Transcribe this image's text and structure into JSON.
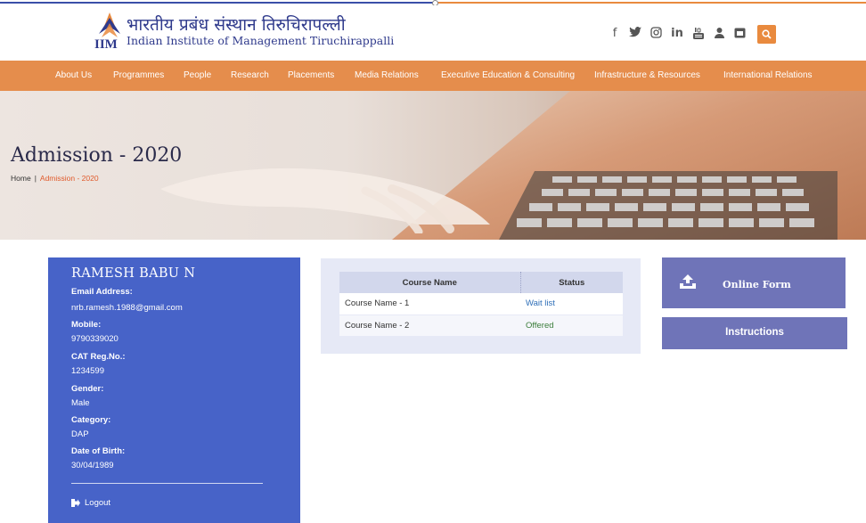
{
  "header": {
    "hindi_name": "भारतीय प्रबंध संस्थान तिरुचिरापल्ली",
    "english_name": "Indian Institute of Management Tiruchirappalli",
    "logo_text": "IIM",
    "logo_sub": "TRICHY",
    "social_icons": [
      "facebook-icon",
      "twitter-icon",
      "instagram-icon",
      "linkedin-icon",
      "youtube-icon",
      "user-icon",
      "calendar-icon"
    ],
    "linkedin_text": "in",
    "facebook_text": "f"
  },
  "nav": {
    "items": [
      "About Us",
      "Programmes",
      "People",
      "Research",
      "Placements",
      "Media Relations",
      "Executive Education & Consulting",
      "Infrastructure & Resources",
      "International Relations"
    ]
  },
  "banner": {
    "title": "Admission - 2020",
    "breadcrumb_home": "Home",
    "breadcrumb_sep": "|",
    "breadcrumb_current": "Admission - 2020"
  },
  "profile": {
    "name": "RAMESH BABU N",
    "fields": [
      {
        "label": "Email Address:",
        "value": "nrb.ramesh.1988@gmail.com"
      },
      {
        "label": "Mobile:",
        "value": "9790339020"
      },
      {
        "label": "CAT Reg.No.:",
        "value": "1234599"
      },
      {
        "label": "Gender:",
        "value": "Male"
      },
      {
        "label": "Category:",
        "value": "DAP"
      },
      {
        "label": "Date of Birth:",
        "value": "30/04/1989"
      }
    ],
    "logout_label": "Logout"
  },
  "courses": {
    "headers": [
      "Course Name",
      "Status"
    ],
    "rows": [
      {
        "course": "Course Name - 1",
        "status": "Wait list"
      },
      {
        "course": "Course Name - 2",
        "status": "Offered"
      }
    ]
  },
  "actions": {
    "online_form_label": "Online Form",
    "instructions_label": "Instructions"
  },
  "colors": {
    "accent_orange": "#e58d4c",
    "profile_blue": "#4763c8",
    "button_purple": "#6f74b8",
    "breadcrumb_current": "#e05a2b"
  }
}
